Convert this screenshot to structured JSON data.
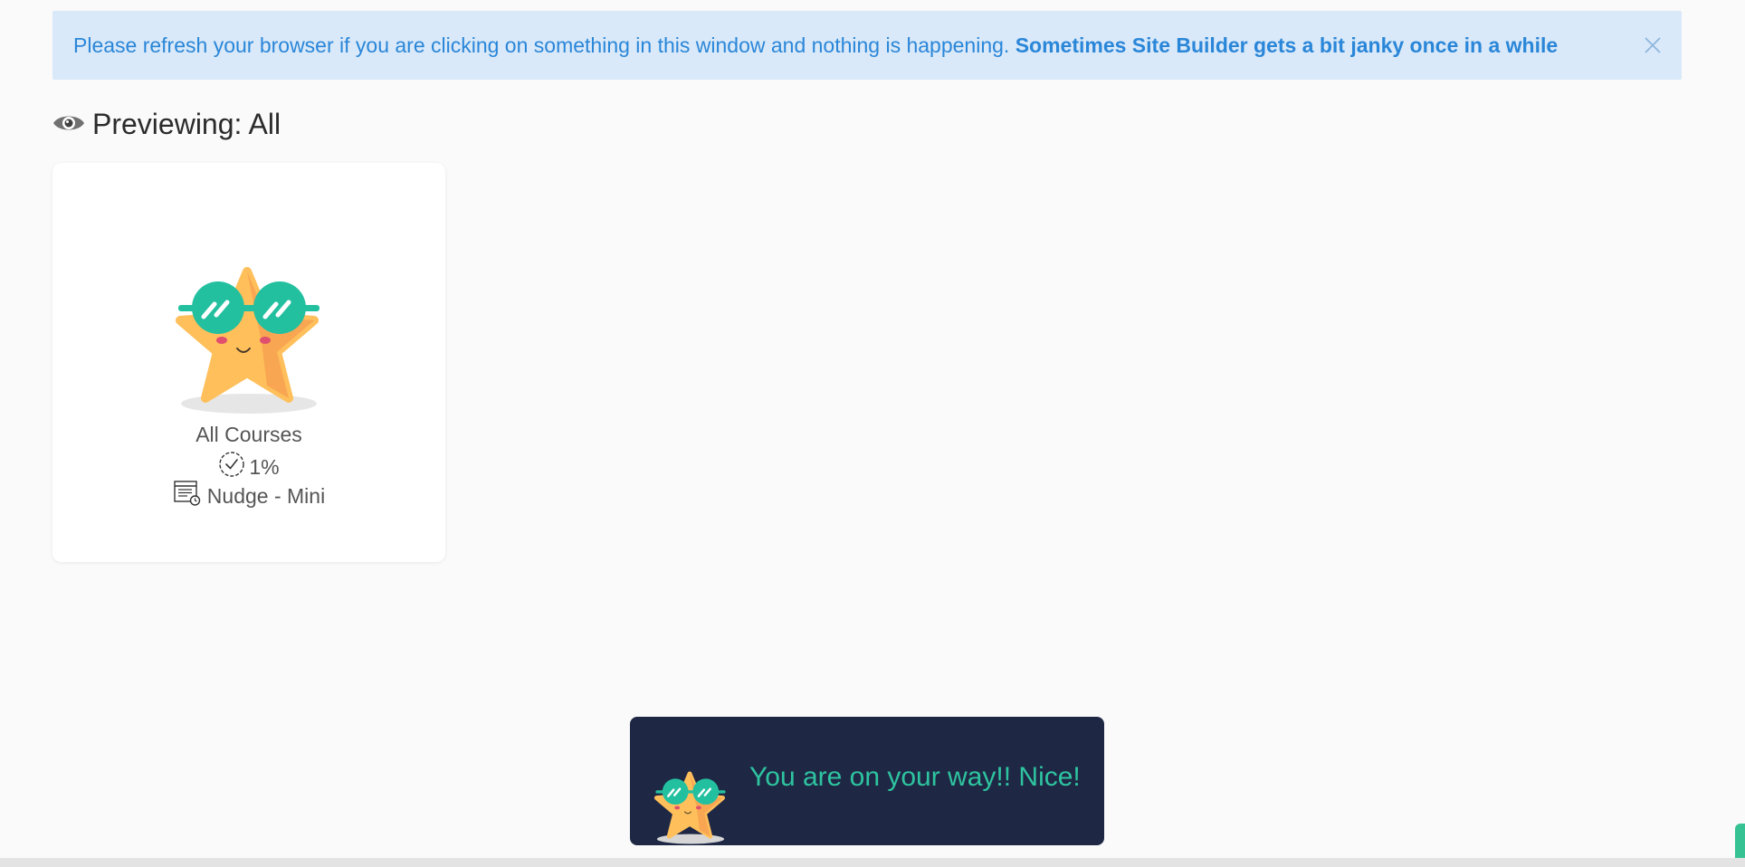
{
  "alert": {
    "message": "Please refresh your browser if you are clicking on something in this window and nothing is happening.",
    "emphasis": "Sometimes Site Builder gets a bit janky once in a while",
    "close_icon": "close-icon"
  },
  "preview": {
    "label": "Previewing: All",
    "icon": "eye-icon"
  },
  "course_card": {
    "title": "All Courses",
    "progress": "1%",
    "progress_icon": "check-circle-icon",
    "program": "Nudge - Mini",
    "program_icon": "program-list-icon"
  },
  "toast": {
    "message": "You are on your way!! Nice!"
  },
  "colors": {
    "alert_bg": "#d9e9f9",
    "alert_text": "#2a86d8",
    "toast_bg": "#1e2845",
    "toast_text": "#2ec4a0",
    "star": "#ffbf5b",
    "glasses": "#23c0a0"
  }
}
